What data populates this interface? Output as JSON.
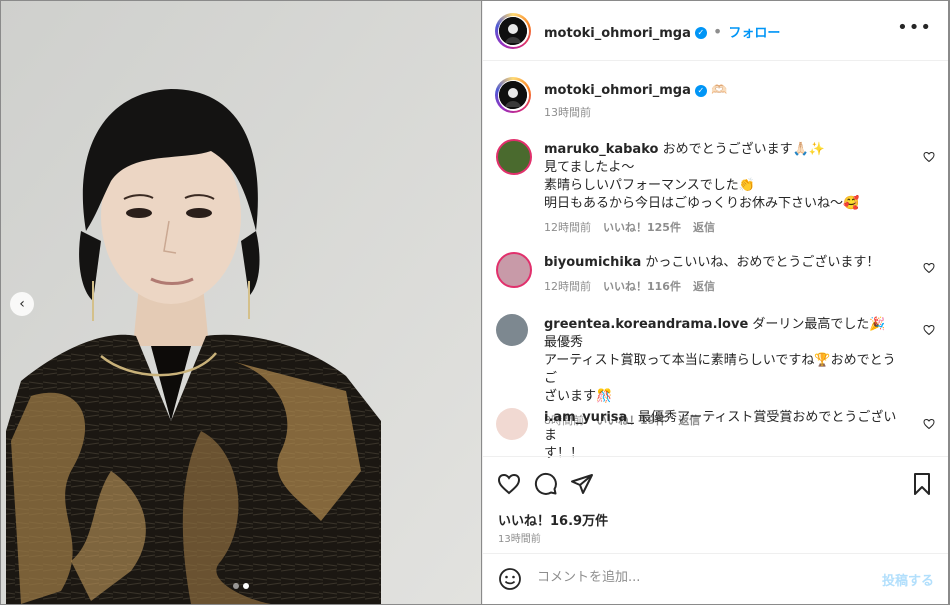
{
  "post": {
    "username": "motoki_ohmori_mga",
    "follow_label": "フォロー",
    "more_label": "•••",
    "caption_emoji": "🫶🏻",
    "caption_time": "13時間前",
    "carousel": {
      "active_index": 1,
      "count": 2
    }
  },
  "comments": [
    {
      "user": "maruko_kabako",
      "lines": [
        "おめでとうございます🙏🏻✨",
        "見てましたよ〜",
        "素晴らしいパフォーマンスでした👏",
        "明日もあるから今日はごゆっくりお休み下さいね〜🥰"
      ],
      "time": "12時間前",
      "likes": "いいね！125件",
      "reply": "返信",
      "avatar_color": "#4a6a2e"
    },
    {
      "user": "biyoumichika",
      "lines": [
        "かっこいいね、おめでとうございます！"
      ],
      "time": "12時間前",
      "likes": "いいね！116件",
      "reply": "返信",
      "avatar_color": "#c89aa8"
    },
    {
      "user": "greentea.koreandrama.love",
      "lines": [
        "ダーリン最高でした🎉　最優秀",
        "アーティスト賞取って本当に素晴らしいですね🏆おめでとうご",
        "ざいます🎊"
      ],
      "time": "8時間前",
      "likes": "いいね！19件",
      "reply": "返信",
      "avatar_color": "#7d8890"
    },
    {
      "user": "i.am_yurisa_",
      "lines": [
        "最優秀アーティスト賞受賞おめでとうございま",
        "す！！"
      ],
      "time": "",
      "likes": "",
      "reply": "",
      "avatar_color": "#f1d9d2"
    }
  ],
  "footer": {
    "likes_label": "いいね！16.9万件",
    "time": "13時間前",
    "comment_placeholder": "コメントを追加...",
    "post_label": "投稿する"
  },
  "icons": {
    "like": "heart-icon",
    "comment": "comment-bubble-icon",
    "share": "paper-plane-icon",
    "save": "bookmark-icon",
    "emoji": "smiley-icon",
    "verified": "verified-badge-icon"
  },
  "colors": {
    "accent": "#0095f6",
    "text": "#262626",
    "muted": "#8e8e8e"
  }
}
